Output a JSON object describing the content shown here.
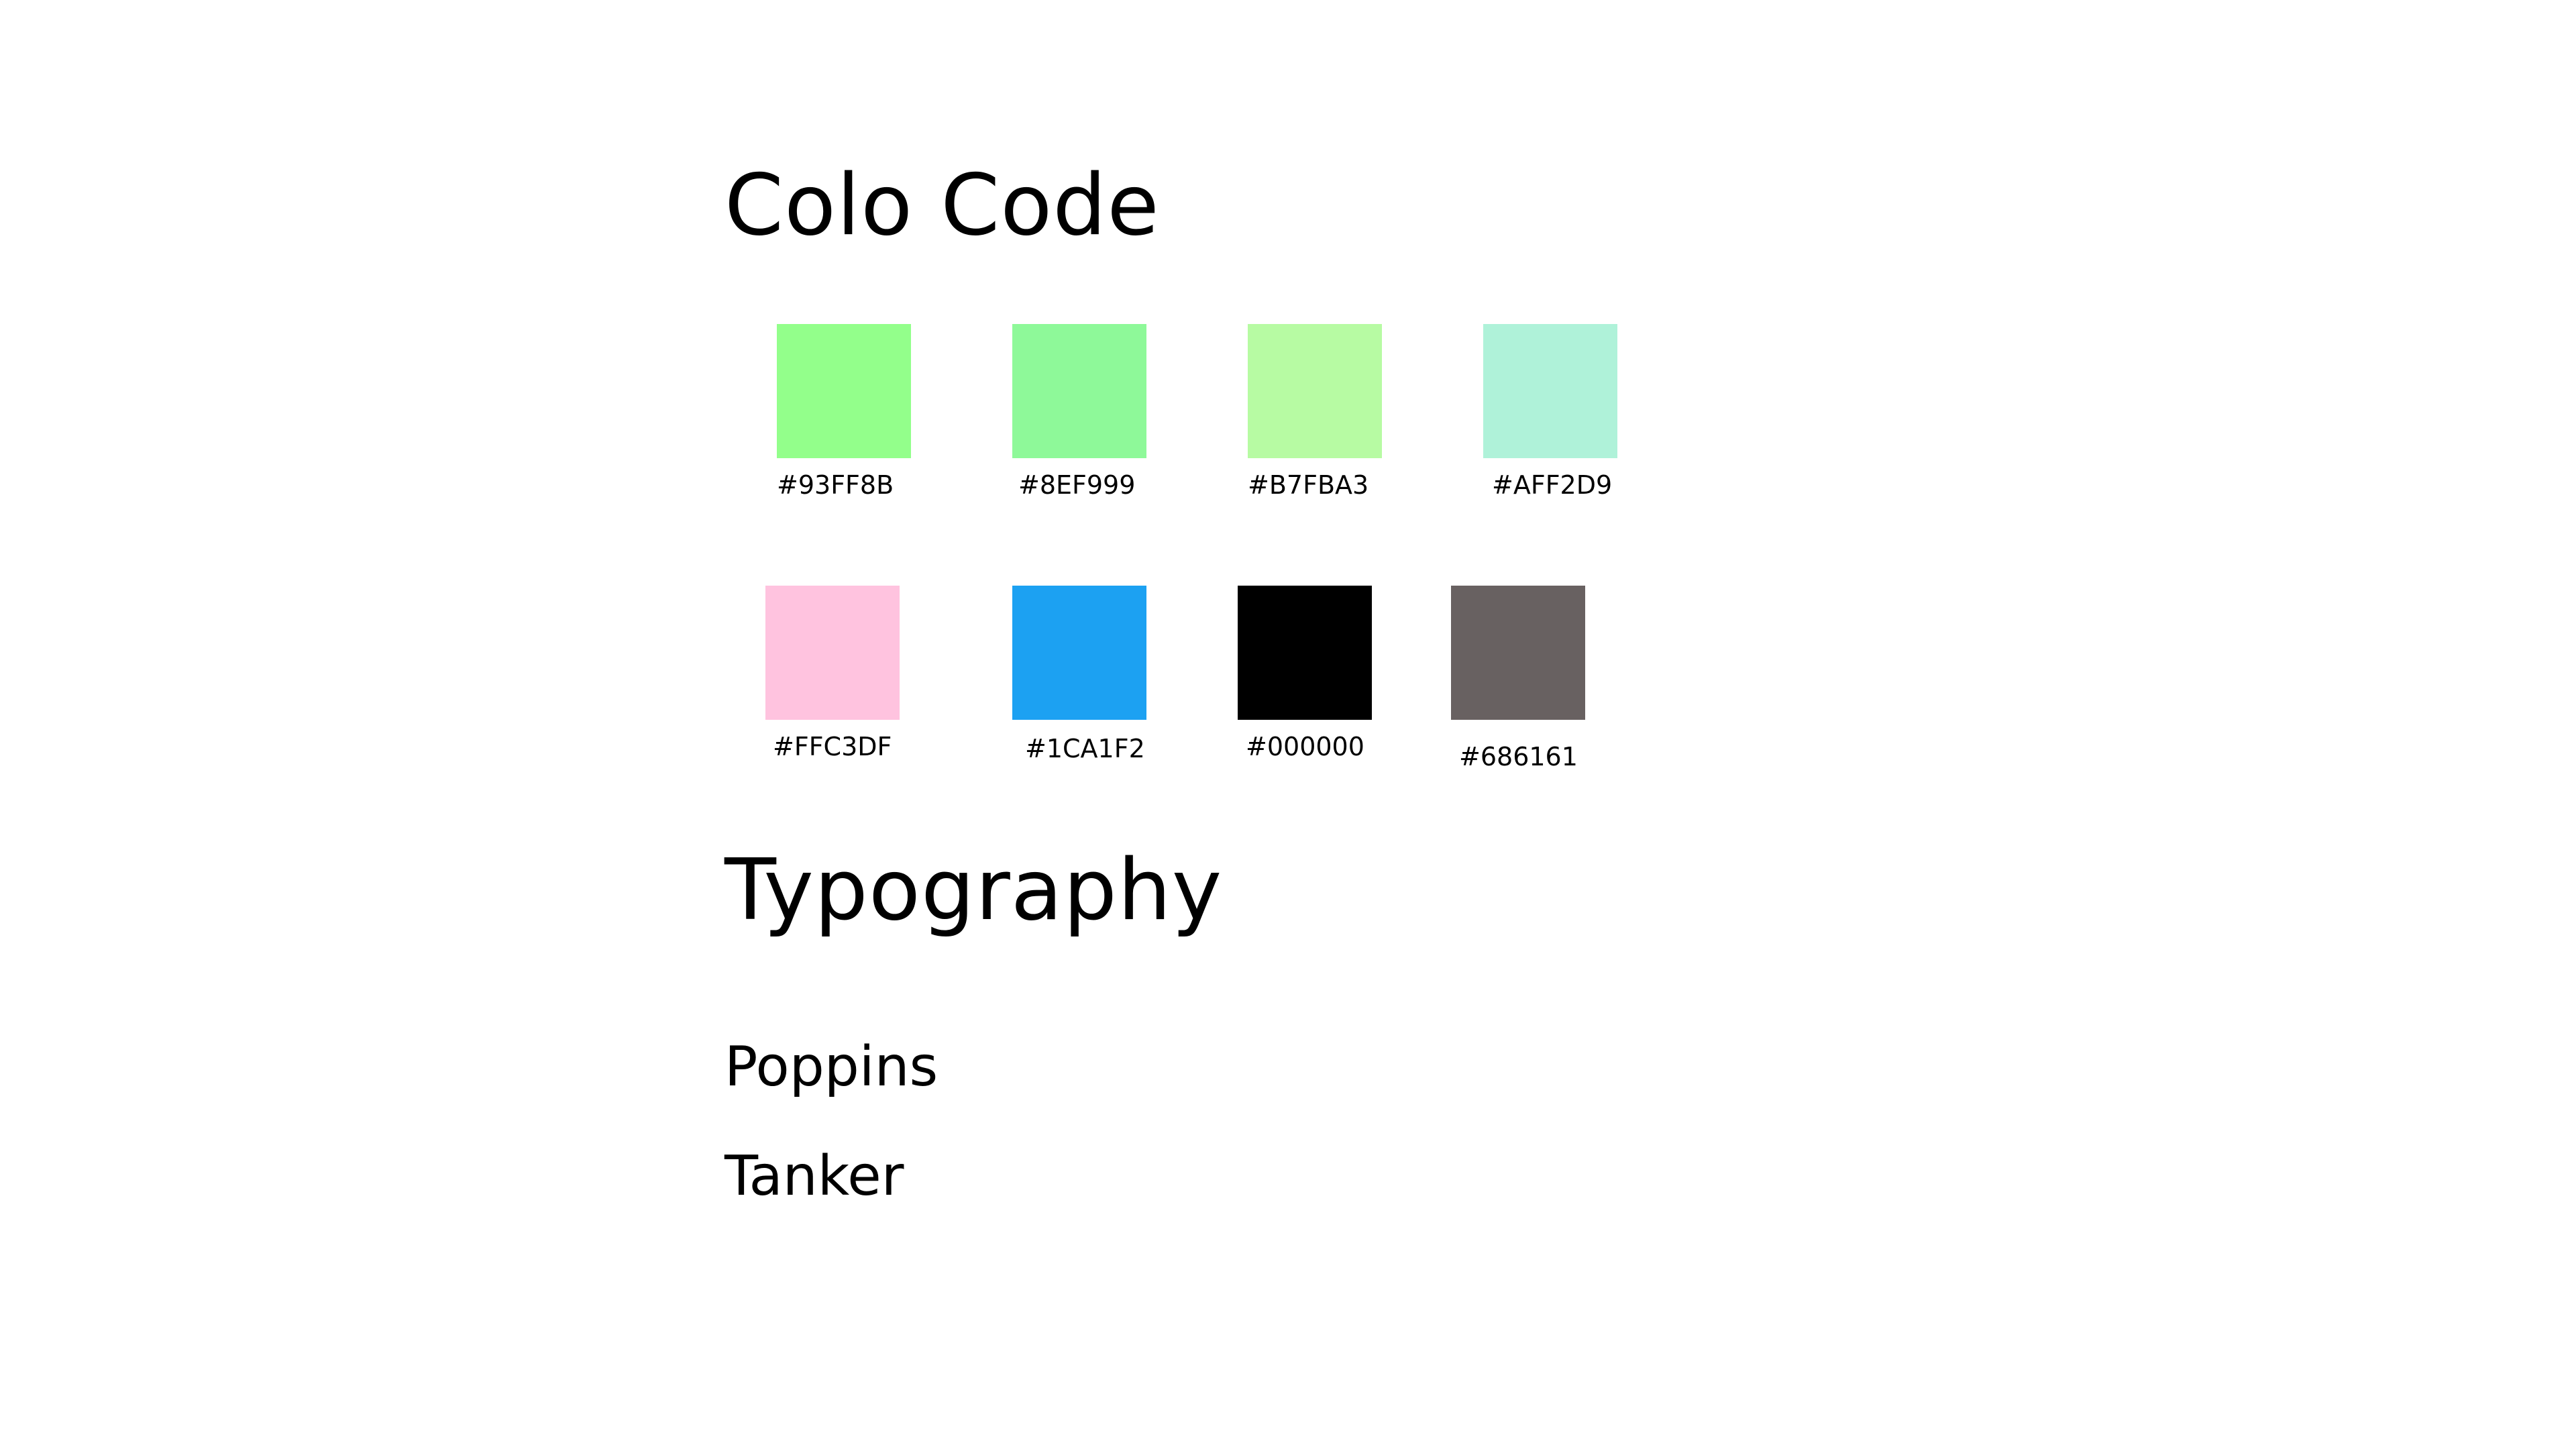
{
  "colors_section": {
    "title": "Colo Code",
    "swatches": [
      {
        "hex": "#93FF8B",
        "label": "#93FF8B"
      },
      {
        "hex": "#8EF999",
        "label": "#8EF999"
      },
      {
        "hex": "#B7FBA3",
        "label": "#B7FBA3"
      },
      {
        "hex": "#AFF2D9",
        "label": "#AFF2D9"
      },
      {
        "hex": "#FFC3DF",
        "label": "#FFC3DF"
      },
      {
        "hex": "#1CA1F2",
        "label": "#1CA1F2"
      },
      {
        "hex": "#000000",
        "label": "#000000"
      },
      {
        "hex": "#686161",
        "label": "#686161"
      }
    ]
  },
  "typography_section": {
    "title": "Typography",
    "fonts": [
      "Poppins",
      "Tanker"
    ]
  }
}
